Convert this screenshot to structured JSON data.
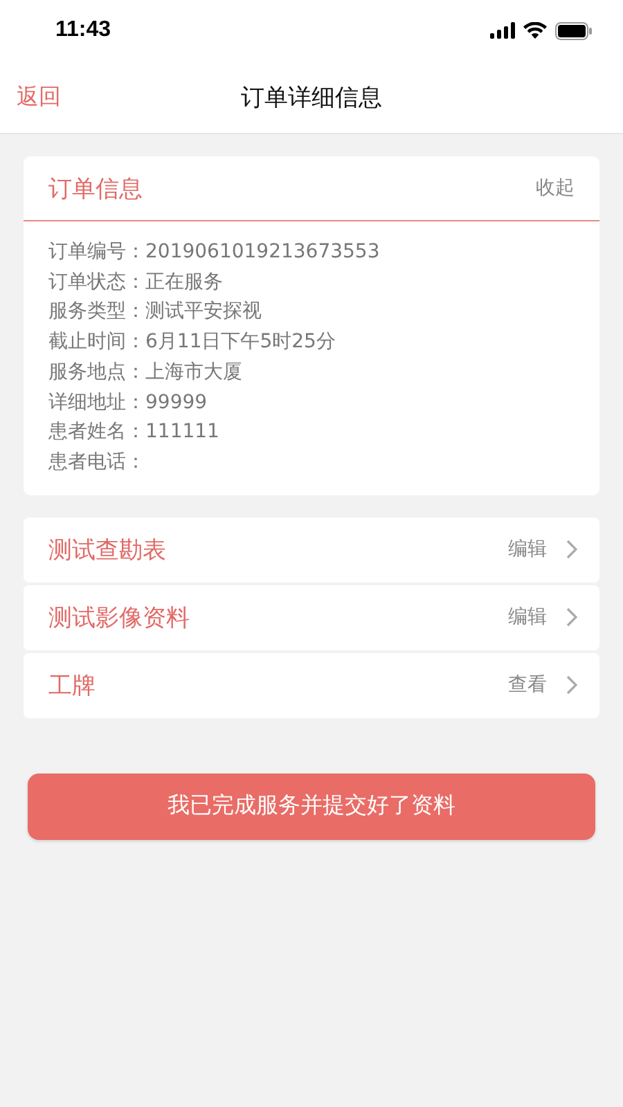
{
  "status_bar": {
    "time": "11:43"
  },
  "nav": {
    "back": "返回",
    "title": "订单详细信息"
  },
  "order_card": {
    "title": "订单信息",
    "toggle": "收起",
    "fields": [
      {
        "label": "订单编号：",
        "value": "2019061019213673553"
      },
      {
        "label": "订单状态：",
        "value": "正在服务"
      },
      {
        "label": "服务类型：",
        "value": "测试平安探视"
      },
      {
        "label": "截止时间：",
        "value": "6月11日下午5时25分"
      },
      {
        "label": "服务地点：",
        "value": "上海市大厦"
      },
      {
        "label": "详细地址：",
        "value": "99999"
      },
      {
        "label": "患者姓名：",
        "value": "111111"
      },
      {
        "label": "患者电话："
      }
    ]
  },
  "rows": [
    {
      "title": "测试查勘表",
      "action": "编辑"
    },
    {
      "title": "测试影像资料",
      "action": "编辑"
    },
    {
      "title": "工牌",
      "action": "查看"
    }
  ],
  "submit_button": "我已完成服务并提交好了资料"
}
